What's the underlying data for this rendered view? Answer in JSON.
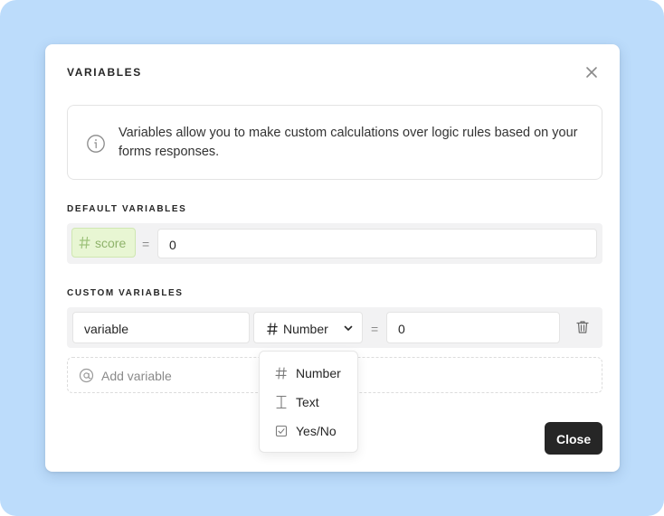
{
  "modal": {
    "title": "VARIABLES",
    "info_text": "Variables allow you to make custom calculations over logic rules based on your forms responses."
  },
  "default_section": {
    "label": "DEFAULT VARIABLES",
    "variables": [
      {
        "name": "score",
        "operator": "=",
        "value": "0"
      }
    ]
  },
  "custom_section": {
    "label": "CUSTOM VARIABLES",
    "variables": [
      {
        "name": "variable",
        "type": "Number",
        "operator": "=",
        "value": "0"
      }
    ],
    "add_label": "Add variable"
  },
  "type_dropdown": {
    "options": [
      {
        "label": "Number",
        "icon": "hash-icon"
      },
      {
        "label": "Text",
        "icon": "text-cursor-icon"
      },
      {
        "label": "Yes/No",
        "icon": "checkbox-icon"
      }
    ]
  },
  "footer": {
    "close_label": "Close"
  },
  "colors": {
    "backdrop": "#bcdcfb",
    "score_chip_bg": "#e8f6d3",
    "score_chip_text": "#8fb36b",
    "primary_button": "#262626"
  }
}
